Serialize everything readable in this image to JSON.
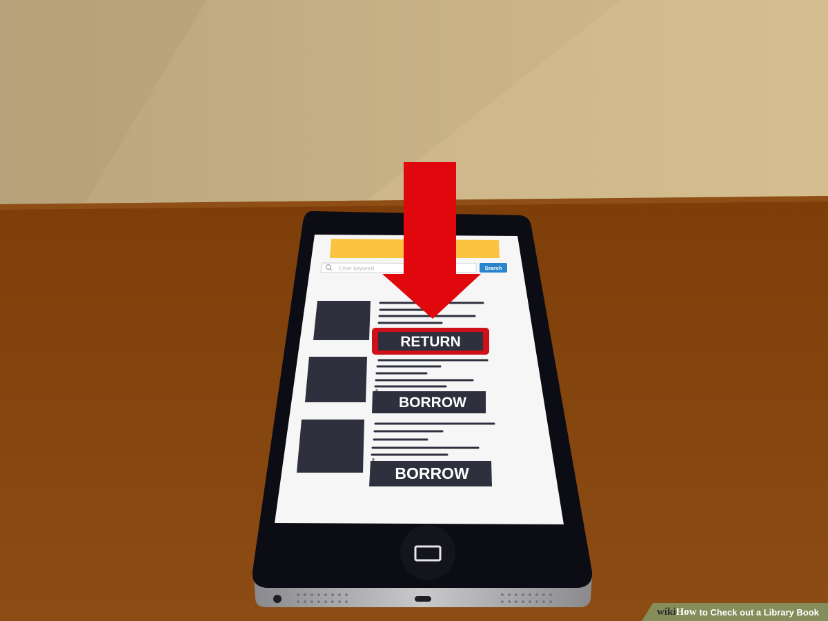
{
  "search": {
    "placeholder": "Enter keyword",
    "button_label": "Search"
  },
  "books": [
    {
      "action_label": "RETURN",
      "highlighted": true
    },
    {
      "action_label": "BORROW",
      "highlighted": false
    },
    {
      "action_label": "BORROW",
      "highlighted": false
    }
  ],
  "watermark": {
    "brand_part1": "wiki",
    "brand_part2": "How",
    "title": "to Check out a Library Book"
  },
  "colors": {
    "wall": "#c8b184",
    "table": "#8a4a10",
    "phone": "#0c0c14",
    "screen": "#f6f6f6",
    "header_bar": "#fbc43e",
    "search_button": "#2a83cc",
    "thumbnail": "#2f303d",
    "action_button": "#2f303d",
    "highlight": "#d01018",
    "arrow": "#e0080d"
  },
  "icons": {
    "search": "magnifier-icon",
    "home": "home-button-icon",
    "arrow": "down-arrow-icon"
  }
}
